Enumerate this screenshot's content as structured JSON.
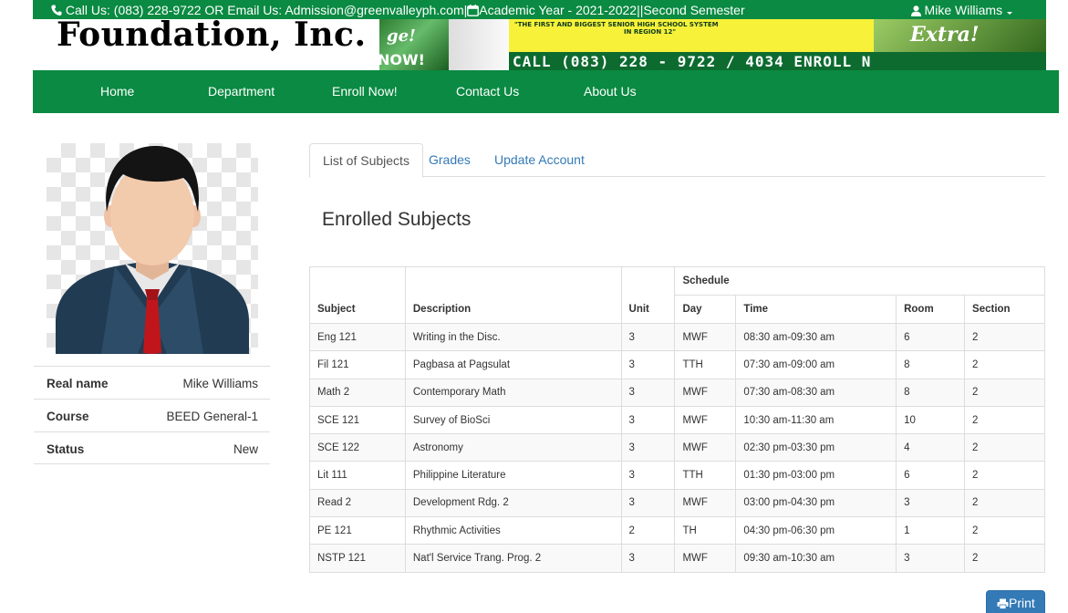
{
  "topbar": {
    "contact": "Call Us: (083) 228-9722 OR Email Us: Admission@greenvalleyph.com",
    "academic_year": "Academic Year - 2021-2022",
    "semester": "Second Semester",
    "user_name": "Mike Williams"
  },
  "banner": {
    "school_name_partial": "Foundation, Inc.",
    "promo_left_word": "now!",
    "promo_yellow_line1": "\"THE FIRST AND BIGGEST SENIOR HIGH SCHOOL SYSTEM",
    "promo_yellow_line2": "IN REGION 12\"",
    "promo_call": "CALL (083) 228 - 9722 / 4034 ENROLL N"
  },
  "nav": {
    "items": [
      "Home",
      "Department",
      "Enroll Now!",
      "Contact Us",
      "About Us"
    ]
  },
  "profile": {
    "avatar_icon": "user-avatar-icon",
    "fields": [
      {
        "label": "Real name",
        "value": "Mike Williams"
      },
      {
        "label": "Course",
        "value": "BEED General-1"
      },
      {
        "label": "Status",
        "value": "New"
      }
    ]
  },
  "tabs": [
    "List of Subjects",
    "Grades",
    "Update Account"
  ],
  "active_tab": "List of Subjects",
  "page_heading": "Enrolled Subjects",
  "table": {
    "group_header": "Schedule",
    "headers": {
      "subject": "Subject",
      "description": "Description",
      "unit": "Unit",
      "day": "Day",
      "time": "Time",
      "room": "Room",
      "section": "Section"
    },
    "rows": [
      {
        "subject": "Eng 121",
        "description": "Writing in the Disc.",
        "unit": "3",
        "day": "MWF",
        "time": "08:30 am-09:30 am",
        "room": "6",
        "section": "2"
      },
      {
        "subject": "Fil 121",
        "description": "Pagbasa at Pagsulat",
        "unit": "3",
        "day": "TTH",
        "time": "07:30 am-09:00 am",
        "room": "8",
        "section": "2"
      },
      {
        "subject": "Math 2",
        "description": "Contemporary Math",
        "unit": "3",
        "day": "MWF",
        "time": "07:30 am-08:30 am",
        "room": "8",
        "section": "2"
      },
      {
        "subject": "SCE 121",
        "description": "Survey of BioSci",
        "unit": "3",
        "day": "MWF",
        "time": "10:30 am-11:30 am",
        "room": "10",
        "section": "2"
      },
      {
        "subject": "SCE 122",
        "description": "Astronomy",
        "unit": "3",
        "day": "MWF",
        "time": "02:30 pm-03:30 pm",
        "room": "4",
        "section": "2"
      },
      {
        "subject": "Lit 111",
        "description": "Philippine Literature",
        "unit": "3",
        "day": "TTH",
        "time": "01:30 pm-03:00 pm",
        "room": "6",
        "section": "2"
      },
      {
        "subject": "Read 2",
        "description": "Development Rdg. 2",
        "unit": "3",
        "day": "MWF",
        "time": "03:00 pm-04:30 pm",
        "room": "3",
        "section": "2"
      },
      {
        "subject": "PE 121",
        "description": "Rhythmic Activities",
        "unit": "2",
        "day": "TH",
        "time": "04:30 pm-06:30 pm",
        "room": "1",
        "section": "2"
      },
      {
        "subject": "NSTP 121",
        "description": "Nat'l Service Trang. Prog. 2",
        "unit": "3",
        "day": "MWF",
        "time": "09:30 am-10:30 am",
        "room": "3",
        "section": "2"
      }
    ]
  },
  "print_button": "Print",
  "colors": {
    "brand_green": "#0a8a42",
    "link_blue": "#337ab7",
    "button_blue": "#337ab7"
  }
}
